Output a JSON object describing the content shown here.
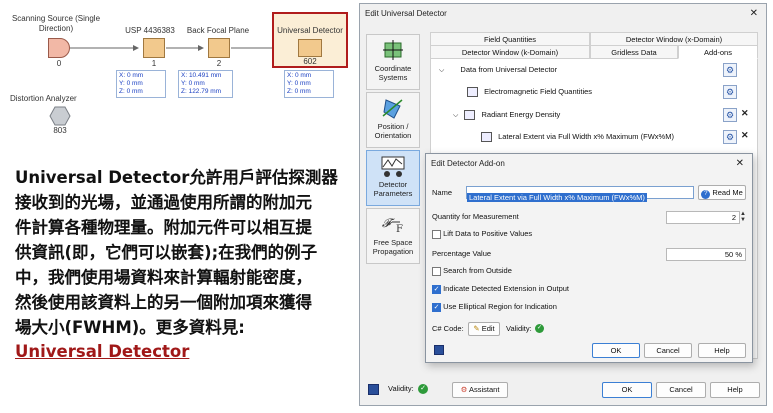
{
  "diagram": {
    "nodes": [
      {
        "label": "Scanning Source (Single Direction)",
        "number": "0"
      },
      {
        "label": "USP 4436383",
        "number": "1"
      },
      {
        "label": "Back Focal Plane",
        "number": "2"
      },
      {
        "label": "Universal Detector",
        "number": "602"
      },
      {
        "label": "Distortion Analyzer",
        "number": "803"
      }
    ],
    "coords": [
      {
        "x": "X: 0 mm",
        "y": "Y: 0 mm",
        "z": "Z: 0 mm"
      },
      {
        "x": "X: 10.491 mm",
        "y": "Y: 0 mm",
        "z": "Z: 122.79 mm"
      },
      {
        "x": "X: 0 mm",
        "y": "Y: 0 mm",
        "z": "Z: 0 mm"
      }
    ]
  },
  "description": {
    "lines": [
      "Universal Detector允許用戶評估探測器",
      "接收到的光場，並通過使用所謂的附加元",
      "件計算各種物理量。附加元件可以相互提",
      "供資訊(即，它們可以嵌套);在我們的例子",
      "中，我們使用場資料來計算輻射能密度，",
      "然後使用該資料上的另一個附加項來獲得",
      "場大小(FWHM)。更多資料見:"
    ],
    "link": "Universal Detector"
  },
  "main_dialog": {
    "title": "Edit Universal Detector",
    "sidebar": [
      {
        "label": "Coordinate Systems"
      },
      {
        "label": "Position / Orientation"
      },
      {
        "label": "Detector Parameters"
      },
      {
        "label": "Free Space Propagation"
      }
    ],
    "tabs_row1": [
      "Field Quantities",
      "Detector Window (x-Domain)"
    ],
    "tabs_row2": [
      "Detector Window (k-Domain)",
      "Gridless Data",
      "Add-ons"
    ],
    "tree": [
      "Data from Universal Detector",
      "Electromagnetic Field Quantities",
      "Radiant Energy Density",
      "Lateral Extent via Full Width x% Maximum (FWx%M)"
    ],
    "validity_label": "Validity:",
    "assistant_label": "Assistant",
    "ok": "OK",
    "cancel": "Cancel",
    "help": "Help"
  },
  "sub_dialog": {
    "title": "Edit Detector Add-on",
    "name_label": "Name",
    "name_value": "Lateral Extent via Full Width x% Maximum (FWx%M)",
    "read_me": "Read Me",
    "quantity_label": "Quantity for Measurement",
    "quantity_value": "2",
    "lift_label": "Lift Data to Positive Values",
    "percentage_label": "Percentage Value",
    "percentage_value": "50 %",
    "search_label": "Search from Outside",
    "indicate_label": "Indicate Detected Extension in Output",
    "elliptical_label": "Use Elliptical Region for Indication",
    "csharp_label": "C# Code:",
    "edit_label": "Edit",
    "validity_label": "Validity:",
    "ok": "OK",
    "cancel": "Cancel",
    "help": "Help"
  },
  "colors": {
    "accent": "#2f6fce",
    "highlight_border": "#b01c1c",
    "node_fill": "#f2c98d",
    "link": "#a01818"
  }
}
